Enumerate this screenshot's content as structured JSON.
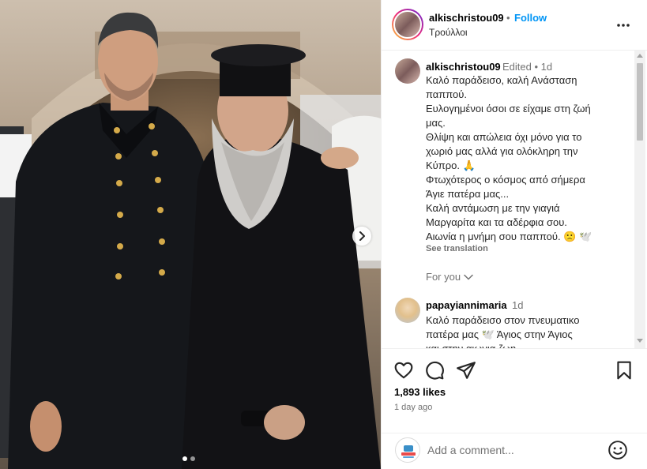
{
  "post": {
    "username": "alkischristou09",
    "separator": "•",
    "follow_label": "Follow",
    "location": "Τρούλλοι"
  },
  "caption": {
    "username": "alkischristou09",
    "meta": "Edited •  1d",
    "lines": [
      "Καλό παράδεισο, καλή Ανάσταση",
      "παππού.",
      "Ευλογημένοι όσοι σε είχαμε στη ζωή",
      "μας.",
      "Θλίψη και απώλεια όχι μόνο για το",
      "χωριό μας αλλά για ολόκληρη την",
      "Κύπρο. 🙏",
      "Φτωχότερος ο κόσμος από σήμερα",
      "Άγιε πατέρα μας...",
      "Καλή αντάμωση με την γιαγιά",
      "Μαργαρίτα και τα αδέρφια σου.",
      "Αιωνία η μνήμη σου παππού. 🙁 🕊️"
    ],
    "see_translation": "See translation"
  },
  "for_you_label": "For you",
  "comment2": {
    "username": "papayiannimaria",
    "time": "1d",
    "lines": [
      "Καλό παράδεισο στον πνευματικο",
      "πατέρα μας 🕊️ Άγιος στην Άγιος",
      "και στην αιωνια ζωη"
    ]
  },
  "stats": {
    "likes": "1,893 likes",
    "time_ago": "1 day ago"
  },
  "add_comment": {
    "placeholder": "Add a comment..."
  },
  "icons": {
    "more": "more-icon",
    "like": "heart-icon",
    "comment": "comment-icon",
    "share": "share-icon",
    "save": "bookmark-icon",
    "emoji": "emoji-icon",
    "next": "chevron-right-icon"
  },
  "colors": {
    "accent": "#0095f6",
    "muted": "#737373"
  },
  "carousel": {
    "slide_count": 2,
    "active_index": 0
  }
}
